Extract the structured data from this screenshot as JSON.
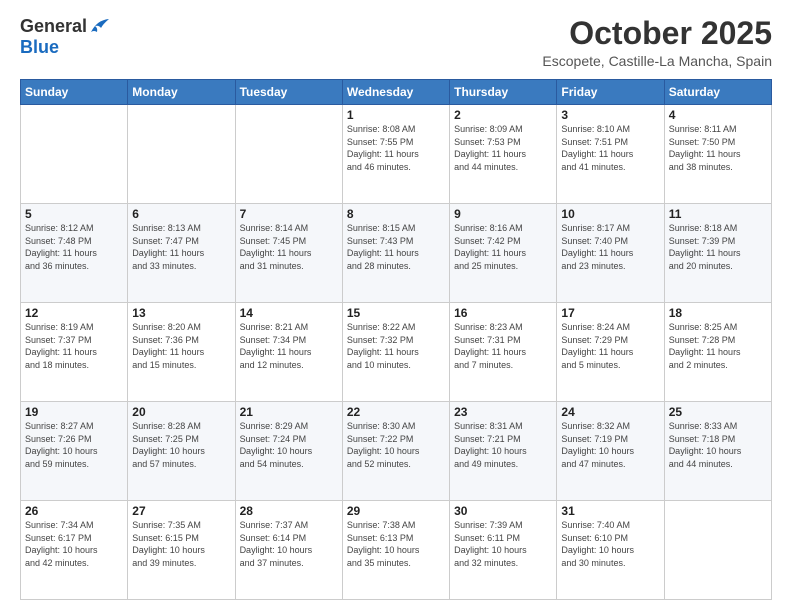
{
  "logo": {
    "general": "General",
    "blue": "Blue"
  },
  "header": {
    "month": "October 2025",
    "location": "Escopete, Castille-La Mancha, Spain"
  },
  "weekdays": [
    "Sunday",
    "Monday",
    "Tuesday",
    "Wednesday",
    "Thursday",
    "Friday",
    "Saturday"
  ],
  "weeks": [
    [
      {
        "day": "",
        "info": ""
      },
      {
        "day": "",
        "info": ""
      },
      {
        "day": "",
        "info": ""
      },
      {
        "day": "1",
        "info": "Sunrise: 8:08 AM\nSunset: 7:55 PM\nDaylight: 11 hours\nand 46 minutes."
      },
      {
        "day": "2",
        "info": "Sunrise: 8:09 AM\nSunset: 7:53 PM\nDaylight: 11 hours\nand 44 minutes."
      },
      {
        "day": "3",
        "info": "Sunrise: 8:10 AM\nSunset: 7:51 PM\nDaylight: 11 hours\nand 41 minutes."
      },
      {
        "day": "4",
        "info": "Sunrise: 8:11 AM\nSunset: 7:50 PM\nDaylight: 11 hours\nand 38 minutes."
      }
    ],
    [
      {
        "day": "5",
        "info": "Sunrise: 8:12 AM\nSunset: 7:48 PM\nDaylight: 11 hours\nand 36 minutes."
      },
      {
        "day": "6",
        "info": "Sunrise: 8:13 AM\nSunset: 7:47 PM\nDaylight: 11 hours\nand 33 minutes."
      },
      {
        "day": "7",
        "info": "Sunrise: 8:14 AM\nSunset: 7:45 PM\nDaylight: 11 hours\nand 31 minutes."
      },
      {
        "day": "8",
        "info": "Sunrise: 8:15 AM\nSunset: 7:43 PM\nDaylight: 11 hours\nand 28 minutes."
      },
      {
        "day": "9",
        "info": "Sunrise: 8:16 AM\nSunset: 7:42 PM\nDaylight: 11 hours\nand 25 minutes."
      },
      {
        "day": "10",
        "info": "Sunrise: 8:17 AM\nSunset: 7:40 PM\nDaylight: 11 hours\nand 23 minutes."
      },
      {
        "day": "11",
        "info": "Sunrise: 8:18 AM\nSunset: 7:39 PM\nDaylight: 11 hours\nand 20 minutes."
      }
    ],
    [
      {
        "day": "12",
        "info": "Sunrise: 8:19 AM\nSunset: 7:37 PM\nDaylight: 11 hours\nand 18 minutes."
      },
      {
        "day": "13",
        "info": "Sunrise: 8:20 AM\nSunset: 7:36 PM\nDaylight: 11 hours\nand 15 minutes."
      },
      {
        "day": "14",
        "info": "Sunrise: 8:21 AM\nSunset: 7:34 PM\nDaylight: 11 hours\nand 12 minutes."
      },
      {
        "day": "15",
        "info": "Sunrise: 8:22 AM\nSunset: 7:32 PM\nDaylight: 11 hours\nand 10 minutes."
      },
      {
        "day": "16",
        "info": "Sunrise: 8:23 AM\nSunset: 7:31 PM\nDaylight: 11 hours\nand 7 minutes."
      },
      {
        "day": "17",
        "info": "Sunrise: 8:24 AM\nSunset: 7:29 PM\nDaylight: 11 hours\nand 5 minutes."
      },
      {
        "day": "18",
        "info": "Sunrise: 8:25 AM\nSunset: 7:28 PM\nDaylight: 11 hours\nand 2 minutes."
      }
    ],
    [
      {
        "day": "19",
        "info": "Sunrise: 8:27 AM\nSunset: 7:26 PM\nDaylight: 10 hours\nand 59 minutes."
      },
      {
        "day": "20",
        "info": "Sunrise: 8:28 AM\nSunset: 7:25 PM\nDaylight: 10 hours\nand 57 minutes."
      },
      {
        "day": "21",
        "info": "Sunrise: 8:29 AM\nSunset: 7:24 PM\nDaylight: 10 hours\nand 54 minutes."
      },
      {
        "day": "22",
        "info": "Sunrise: 8:30 AM\nSunset: 7:22 PM\nDaylight: 10 hours\nand 52 minutes."
      },
      {
        "day": "23",
        "info": "Sunrise: 8:31 AM\nSunset: 7:21 PM\nDaylight: 10 hours\nand 49 minutes."
      },
      {
        "day": "24",
        "info": "Sunrise: 8:32 AM\nSunset: 7:19 PM\nDaylight: 10 hours\nand 47 minutes."
      },
      {
        "day": "25",
        "info": "Sunrise: 8:33 AM\nSunset: 7:18 PM\nDaylight: 10 hours\nand 44 minutes."
      }
    ],
    [
      {
        "day": "26",
        "info": "Sunrise: 7:34 AM\nSunset: 6:17 PM\nDaylight: 10 hours\nand 42 minutes."
      },
      {
        "day": "27",
        "info": "Sunrise: 7:35 AM\nSunset: 6:15 PM\nDaylight: 10 hours\nand 39 minutes."
      },
      {
        "day": "28",
        "info": "Sunrise: 7:37 AM\nSunset: 6:14 PM\nDaylight: 10 hours\nand 37 minutes."
      },
      {
        "day": "29",
        "info": "Sunrise: 7:38 AM\nSunset: 6:13 PM\nDaylight: 10 hours\nand 35 minutes."
      },
      {
        "day": "30",
        "info": "Sunrise: 7:39 AM\nSunset: 6:11 PM\nDaylight: 10 hours\nand 32 minutes."
      },
      {
        "day": "31",
        "info": "Sunrise: 7:40 AM\nSunset: 6:10 PM\nDaylight: 10 hours\nand 30 minutes."
      },
      {
        "day": "",
        "info": ""
      }
    ]
  ]
}
